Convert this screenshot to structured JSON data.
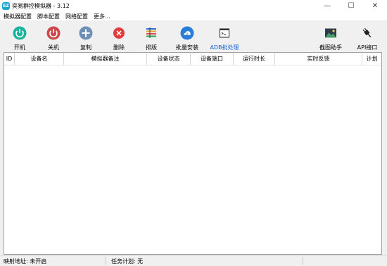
{
  "window": {
    "title": "奕易群控模拟器 - 3.12",
    "icon_name": "app-logo-icon",
    "controls": [
      "minimize-icon",
      "maximize-icon",
      "close-icon"
    ]
  },
  "menu": {
    "items": [
      "模拟器配置",
      "脚本配置",
      "网络配置",
      "更多..."
    ]
  },
  "toolbar": {
    "buttons": [
      {
        "label": "开机",
        "icon": "power-on-icon",
        "color": "#1ab39b"
      },
      {
        "label": "关机",
        "icon": "power-off-icon",
        "color": "#c94a4a"
      },
      {
        "label": "复制",
        "icon": "plus-icon",
        "color": "#6d8fb8"
      },
      {
        "label": "删除",
        "icon": "delete-icon",
        "color": "#e03c3c"
      },
      {
        "label": "排版",
        "icon": "layout-icon",
        "color": "#e8a23a"
      },
      {
        "label": "批量安装",
        "icon": "install-cloud-icon",
        "color": "#2b7ed8"
      },
      {
        "label": "ADB批处理",
        "icon": "terminal-icon",
        "color": "#333333"
      },
      {
        "label": "截图助手",
        "icon": "screenshot-icon",
        "color": "#3a7a5e"
      },
      {
        "label": "API接口",
        "icon": "plug-icon",
        "color": "#222222"
      }
    ]
  },
  "table": {
    "columns": [
      "ID",
      "设备名",
      "模拟器备注",
      "设备状态",
      "设备端口",
      "运行时长",
      "实时反馈",
      "计划"
    ]
  },
  "status": {
    "mapping_address_label": "映射地址: 未开启",
    "task_plan_label": "任务计划: 无"
  }
}
